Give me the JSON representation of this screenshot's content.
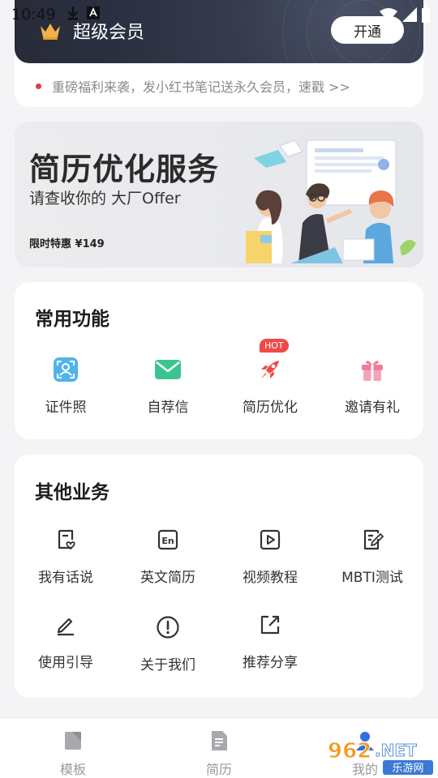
{
  "status_bar": {
    "time": "10:49"
  },
  "member": {
    "title": "超级会员",
    "open_button": "开通",
    "notice": "重磅福利来袭，发小红书笔记送永久会员，速戳 >>"
  },
  "banner": {
    "title": "简历优化服务",
    "subtitle": "请查收你的 大厂Offer",
    "price": "限时特惠 ¥149"
  },
  "common": {
    "title": "常用功能",
    "items": [
      {
        "label": "证件照",
        "icon": "id-photo-icon"
      },
      {
        "label": "自荐信",
        "icon": "envelope-icon"
      },
      {
        "label": "简历优化",
        "icon": "rocket-icon",
        "badge": "HOT"
      },
      {
        "label": "邀请有礼",
        "icon": "gift-icon"
      }
    ]
  },
  "other": {
    "title": "其他业务",
    "items": [
      {
        "label": "我有话说",
        "icon": "feedback-icon"
      },
      {
        "label": "英文简历",
        "icon": "english-icon"
      },
      {
        "label": "视频教程",
        "icon": "play-video-icon"
      },
      {
        "label": "MBTI测试",
        "icon": "test-edit-icon"
      },
      {
        "label": "使用引导",
        "icon": "pencil-icon"
      },
      {
        "label": "关于我们",
        "icon": "info-icon"
      },
      {
        "label": "推荐分享",
        "icon": "share-icon"
      }
    ]
  },
  "nav": {
    "items": [
      {
        "label": "模板",
        "icon": "template-icon"
      },
      {
        "label": "简历",
        "icon": "resume-icon"
      },
      {
        "label": "我的",
        "icon": "profile-icon"
      }
    ]
  },
  "watermark": {
    "text": "962.NET",
    "sub": "乐游网"
  },
  "colors": {
    "accent_red": "#ee4a4a",
    "card_dark": "#2f3445",
    "icon_blue": "#4fb3ec",
    "icon_green": "#3cc48e",
    "icon_pink": "#f07c9a"
  }
}
